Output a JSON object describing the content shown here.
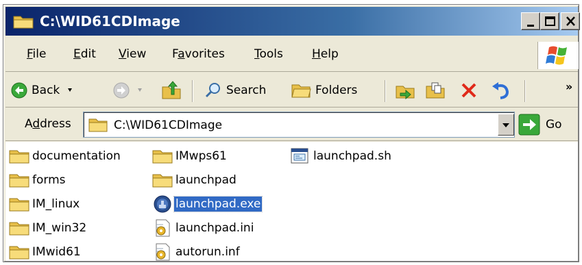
{
  "window": {
    "title": "C:\\WID61CDImage",
    "icon": "folder-icon",
    "controls": [
      "minimize-icon",
      "maximize-icon",
      "close-icon"
    ]
  },
  "menu": {
    "items": [
      {
        "prefix": "",
        "hot": "F",
        "rest": "ile"
      },
      {
        "prefix": "",
        "hot": "E",
        "rest": "dit"
      },
      {
        "prefix": "",
        "hot": "V",
        "rest": "iew"
      },
      {
        "prefix": "F",
        "hot": "a",
        "rest": "vorites"
      },
      {
        "prefix": "",
        "hot": "T",
        "rest": "ools"
      },
      {
        "prefix": "",
        "hot": "H",
        "rest": "elp"
      }
    ]
  },
  "toolbar": {
    "back_label": "Back",
    "search_label": "Search",
    "folders_label": "Folders",
    "overflow": "»"
  },
  "address": {
    "label_prefix": "A",
    "label_hot": "d",
    "label_rest": "dress",
    "value": "C:\\WID61CDImage",
    "go_label": "Go"
  },
  "files": [
    {
      "name": "documentation",
      "icon": "folder-icon",
      "selected": false
    },
    {
      "name": "forms",
      "icon": "folder-icon",
      "selected": false
    },
    {
      "name": "IM_linux",
      "icon": "folder-icon",
      "selected": false
    },
    {
      "name": "IM_win32",
      "icon": "folder-icon",
      "selected": false
    },
    {
      "name": "IMwid61",
      "icon": "folder-icon",
      "selected": false
    },
    {
      "name": "IMwps61",
      "icon": "folder-icon",
      "selected": false
    },
    {
      "name": "launchpad",
      "icon": "folder-icon",
      "selected": false
    },
    {
      "name": "launchpad.exe",
      "icon": "exe-icon",
      "selected": true
    },
    {
      "name": "launchpad.ini",
      "icon": "settings-file-icon",
      "selected": false
    },
    {
      "name": "autorun.inf",
      "icon": "settings-file-icon",
      "selected": false
    },
    {
      "name": "launchpad.sh",
      "icon": "script-file-icon",
      "selected": false
    }
  ],
  "colors": {
    "title_start": "#0a246a",
    "title_end": "#a6caf0",
    "selection": "#316ac5",
    "chrome": "#ece9d8"
  }
}
